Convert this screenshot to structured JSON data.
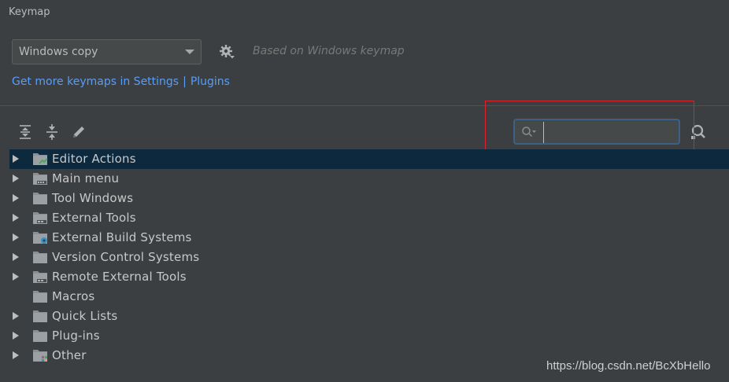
{
  "panel_title": "Keymap",
  "keymap_select": {
    "value": "Windows copy"
  },
  "based_on": "Based on Windows keymap",
  "links": {
    "get_more": "Get more keymaps in Settings",
    "separator": "|",
    "plugins": "Plugins"
  },
  "toolbar": {
    "icons": [
      "expand-all-icon",
      "collapse-all-icon",
      "edit-icon"
    ]
  },
  "search": {
    "value": "",
    "placeholder": ""
  },
  "tree": [
    {
      "label": "Editor Actions",
      "icon": "editor-actions-folder-icon",
      "expandable": true,
      "selected": true
    },
    {
      "label": "Main menu",
      "icon": "menu-folder-icon",
      "expandable": true,
      "selected": false
    },
    {
      "label": "Tool Windows",
      "icon": "folder-icon",
      "expandable": true,
      "selected": false
    },
    {
      "label": "External Tools",
      "icon": "tools-folder-icon",
      "expandable": true,
      "selected": false
    },
    {
      "label": "External Build Systems",
      "icon": "build-folder-icon",
      "expandable": true,
      "selected": false
    },
    {
      "label": "Version Control Systems",
      "icon": "folder-icon",
      "expandable": true,
      "selected": false
    },
    {
      "label": "Remote External Tools",
      "icon": "tools-folder-icon",
      "expandable": true,
      "selected": false
    },
    {
      "label": "Macros",
      "icon": "folder-icon",
      "expandable": false,
      "selected": false
    },
    {
      "label": "Quick Lists",
      "icon": "folder-icon",
      "expandable": true,
      "selected": false
    },
    {
      "label": "Plug-ins",
      "icon": "folder-icon",
      "expandable": true,
      "selected": false
    },
    {
      "label": "Other",
      "icon": "other-folder-icon",
      "expandable": true,
      "selected": false
    }
  ],
  "watermark": "https://blog.csdn.net/BcXbHello",
  "colors": {
    "background": "#3c3f41",
    "link": "#589df6",
    "selection": "#0d293e",
    "highlight_box": "#e0202a"
  }
}
